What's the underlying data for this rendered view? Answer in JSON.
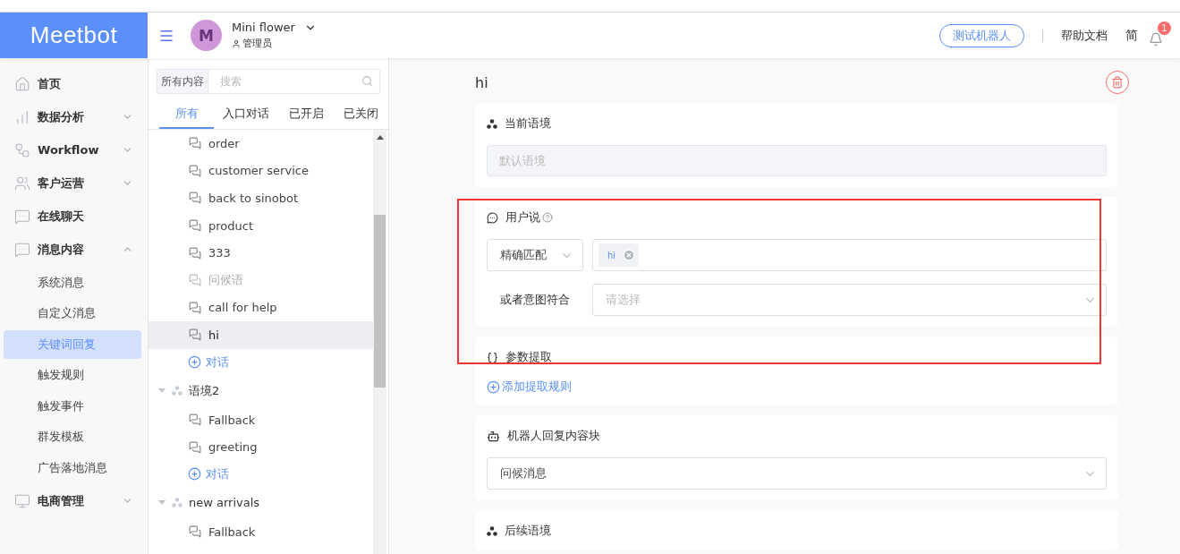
{
  "header": {
    "logo": "Meetbot",
    "account": {
      "initial": "M",
      "name": "Mini flower",
      "role": "管理员"
    },
    "test_button": "测试机器人",
    "help_link": "帮助文档",
    "language": "简",
    "notifications": "1"
  },
  "sidebar": {
    "items": [
      {
        "label": "首页"
      },
      {
        "label": "数据分析",
        "expanded": false
      },
      {
        "label": "Workflow",
        "expanded": false
      },
      {
        "label": "客户运营",
        "expanded": false
      },
      {
        "label": "在线聊天"
      },
      {
        "label": "消息内容",
        "expanded": true,
        "children": [
          {
            "label": "系统消息",
            "selected": false
          },
          {
            "label": "自定义消息",
            "selected": false
          },
          {
            "label": "关键词回复",
            "selected": true
          },
          {
            "label": "触发规则",
            "selected": false
          },
          {
            "label": "触发事件",
            "selected": false
          },
          {
            "label": "群发模板",
            "selected": false
          },
          {
            "label": "广告落地消息",
            "selected": false
          }
        ]
      },
      {
        "label": "电商管理",
        "expanded": false
      }
    ]
  },
  "list_panel": {
    "scope": "所有内容",
    "search": {
      "placeholder": "搜索"
    },
    "tabs": [
      {
        "label": "所有",
        "selected": true
      },
      {
        "label": "入口对话",
        "selected": false
      },
      {
        "label": "已开启",
        "selected": false
      },
      {
        "label": "已关闭",
        "selected": false
      }
    ],
    "tree": [
      {
        "add_label": "对话",
        "children": [
          {
            "label": "order",
            "selected": false,
            "disabled": false
          },
          {
            "label": "customer service",
            "selected": false,
            "disabled": false
          },
          {
            "label": "back to sinobot",
            "selected": false,
            "disabled": false
          },
          {
            "label": "product",
            "selected": false,
            "disabled": false
          },
          {
            "label": "333",
            "selected": false,
            "disabled": false
          },
          {
            "label": "问候语",
            "selected": false,
            "disabled": true
          },
          {
            "label": "call for help",
            "selected": false,
            "disabled": false
          },
          {
            "label": "hi",
            "selected": true,
            "disabled": false
          }
        ]
      },
      {
        "name": "语境2",
        "expanded": true,
        "add_label": "对话",
        "children": [
          {
            "label": "Fallback",
            "selected": false,
            "disabled": false
          },
          {
            "label": "greeting",
            "selected": false,
            "disabled": false
          }
        ]
      },
      {
        "name": "new arrivals",
        "expanded": true,
        "children": [
          {
            "label": "Fallback",
            "selected": false,
            "disabled": false
          }
        ]
      }
    ]
  },
  "editor": {
    "title": "hi",
    "sections": [
      {
        "kind": "context",
        "title": "当前语境",
        "placeholder": "默认语境"
      },
      {
        "kind": "user_says",
        "title": "用户说",
        "match": "精确匹配",
        "tags": [
          "hi"
        ],
        "intent_label": "或者意图符合",
        "intent_placeholder": "请选择"
      },
      {
        "kind": "params",
        "title": "参数提取",
        "add_link": "添加提取规则"
      },
      {
        "kind": "reply",
        "title": "机器人回复内容块",
        "value": "问候消息"
      },
      {
        "kind": "next_context",
        "title": "后续语境"
      }
    ]
  }
}
